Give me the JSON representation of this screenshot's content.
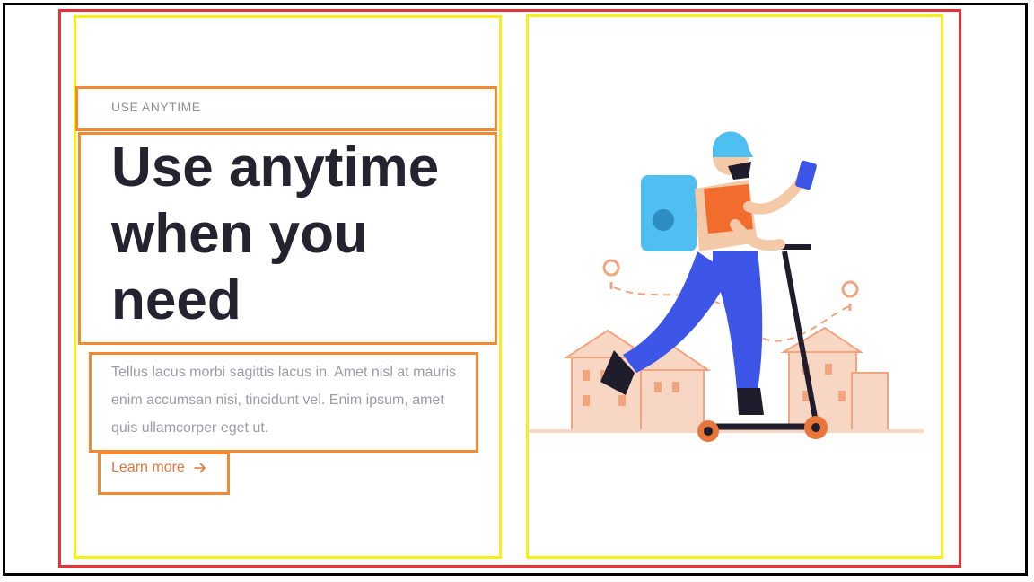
{
  "hero": {
    "eyebrow": "USE ANYTIME",
    "heading": "Use anytime\nwhen you\nneed",
    "body": "Tellus lacus morbi sagittis lacus in. Amet nisl at mauris enim accumsan nisi, tincidunt vel. Enim ipsum, amet quis ullamcorper eget ut.",
    "link_label": "Learn more",
    "link_icon": "arrow-right-icon"
  },
  "illustration": {
    "subject": "delivery-courier-on-scooter-illustration"
  },
  "colors": {
    "accent": "#e8753a",
    "heading": "#25232f",
    "muted": "#9d9ba4",
    "frame_red": "#e53238",
    "frame_yellow": "#f7ef1c",
    "frame_orange": "#f28a34"
  }
}
